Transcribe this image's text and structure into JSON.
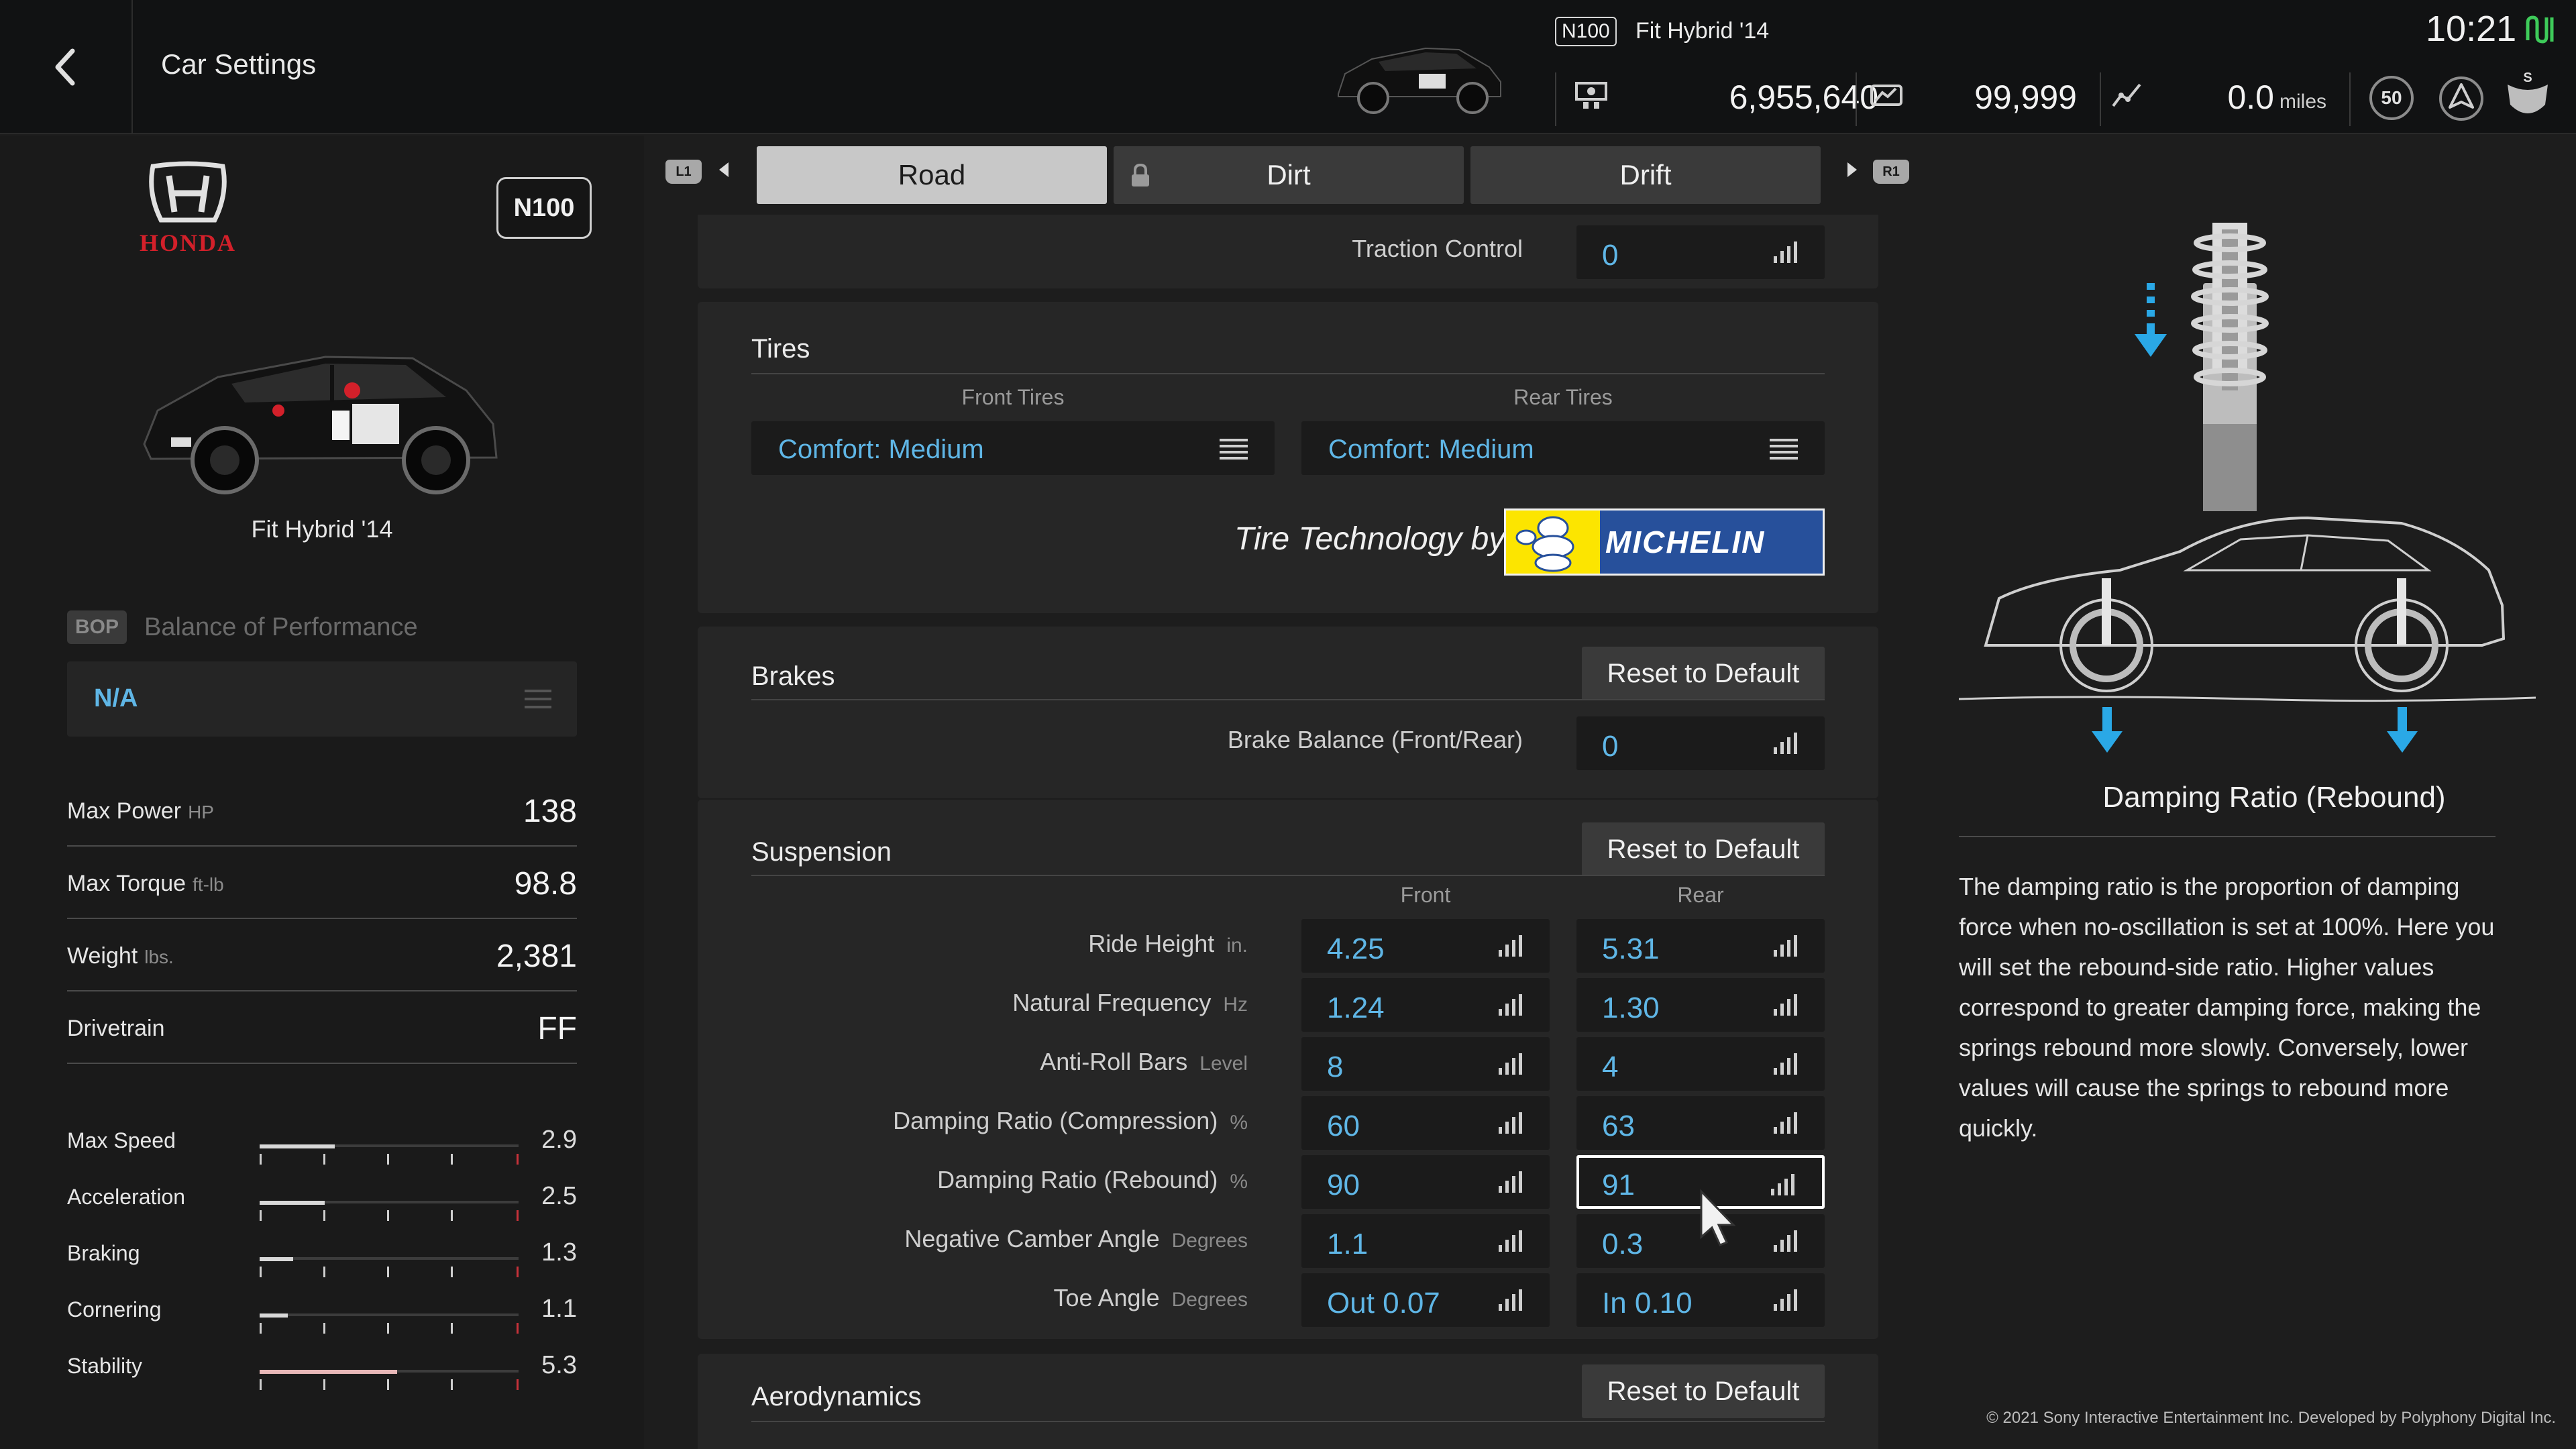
{
  "header": {
    "title": "Car Settings",
    "car_class": "N100",
    "car_name": "Fit Hybrid '14",
    "credits": "6,955,640",
    "mileage_points": "99,999",
    "odometer": "0.0",
    "odometer_unit": "miles",
    "badge_level": "50",
    "clock": "10:21"
  },
  "car_panel": {
    "manufacturer": "HONDA",
    "class_badge": "N100",
    "car_name": "Fit Hybrid '14",
    "bop_tag": "BOP",
    "bop_label": "Balance of Performance",
    "bop_value": "N/A",
    "specs": [
      {
        "label": "Max Power",
        "unit": "HP",
        "value": "138"
      },
      {
        "label": "Max Torque",
        "unit": "ft-lb",
        "value": "98.8"
      },
      {
        "label": "Weight",
        "unit": "lbs.",
        "value": "2,381"
      },
      {
        "label": "Drivetrain",
        "unit": "",
        "value": "FF"
      }
    ],
    "performance": [
      {
        "label": "Max Speed",
        "value": "2.9",
        "level": 0.29
      },
      {
        "label": "Acceleration",
        "value": "2.5",
        "level": 0.25
      },
      {
        "label": "Braking",
        "value": "1.3",
        "level": 0.13
      },
      {
        "label": "Cornering",
        "value": "1.1",
        "level": 0.11
      },
      {
        "label": "Stability",
        "value": "5.3",
        "level": 0.53
      }
    ]
  },
  "tabs": {
    "left_shoulder": "L1",
    "right_shoulder": "R1",
    "items": [
      "Road",
      "Dirt",
      "Drift"
    ],
    "active": "Road",
    "locked": "Dirt"
  },
  "settings": {
    "traction_control": {
      "label": "Traction Control",
      "value": "0"
    },
    "tires": {
      "title": "Tires",
      "front_header": "Front Tires",
      "rear_header": "Rear Tires",
      "front": "Comfort: Medium",
      "rear": "Comfort: Medium",
      "tech_label": "Tire Technology by",
      "sponsor": "MICHELIN"
    },
    "brakes": {
      "title": "Brakes",
      "reset_label": "Reset to Default",
      "balance_label": "Brake Balance (Front/Rear)",
      "balance_value": "0"
    },
    "suspension": {
      "title": "Suspension",
      "reset_label": "Reset to Default",
      "front_header": "Front",
      "rear_header": "Rear",
      "rows": [
        {
          "label": "Ride Height",
          "unit": "in.",
          "front": "4.25",
          "rear": "5.31"
        },
        {
          "label": "Natural Frequency",
          "unit": "Hz",
          "front": "1.24",
          "rear": "1.30"
        },
        {
          "label": "Anti-Roll Bars",
          "unit": "Level",
          "front": "8",
          "rear": "4"
        },
        {
          "label": "Damping Ratio (Compression)",
          "unit": "%",
          "front": "60",
          "rear": "63"
        },
        {
          "label": "Damping Ratio (Rebound)",
          "unit": "%",
          "front": "90",
          "rear": "91"
        },
        {
          "label": "Negative Camber Angle",
          "unit": "Degrees",
          "front": "1.1",
          "rear": "0.3"
        },
        {
          "label": "Toe Angle",
          "unit": "Degrees",
          "front": "Out 0.07",
          "rear": "In 0.10"
        }
      ]
    },
    "aerodynamics": {
      "title": "Aerodynamics",
      "reset_label": "Reset to Default"
    }
  },
  "help": {
    "title": "Damping Ratio (Rebound)",
    "body": "The damping ratio is the proportion of damping force when no-oscillation is set at 100%. Here you will set the rebound-side ratio. Higher values correspond to greater damping force, making the springs rebound more slowly. Conversely, lower values will cause the springs to rebound more quickly."
  },
  "footer": {
    "copyright": "© 2021 Sony Interactive Entertainment Inc. Developed by Polyphony Digital Inc."
  },
  "colors": {
    "accent_blue": "#5fb6e6",
    "honda_red": "#d3202a",
    "signal_green": "#3ecb5a"
  },
  "icons": [
    "back-arrow-icon",
    "credits-icon",
    "mileage-icon",
    "odometer-icon",
    "level-badge-icon",
    "driver-rank-icon",
    "shield-icon",
    "signal-icon",
    "bars-icon",
    "menu-icon",
    "lock-icon",
    "suspension-diagram-icon",
    "mouse-cursor-icon"
  ]
}
